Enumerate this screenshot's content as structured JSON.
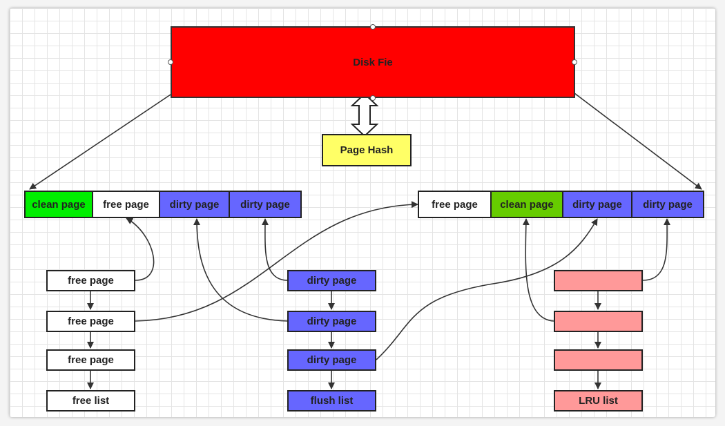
{
  "disk_file": {
    "label": "Disk Fie"
  },
  "page_hash": {
    "label": "Page Hash"
  },
  "buffer_pool_left": [
    "clean page",
    "free page",
    "dirty page",
    "dirty page"
  ],
  "buffer_pool_right": [
    "free page",
    "clean page",
    "dirty page",
    "dirty page"
  ],
  "free_list": {
    "items": [
      "free page",
      "free page",
      "free page"
    ],
    "label": "free list"
  },
  "flush_list": {
    "items": [
      "dirty page",
      "dirty page",
      "dirty page"
    ],
    "label": "flush list"
  },
  "lru_list": {
    "items": [
      "",
      "",
      ""
    ],
    "label": "LRU list"
  },
  "colors": {
    "disk_file": "#ff0000",
    "page_hash": "#ffff66",
    "clean_page_left": "#00ee00",
    "clean_page_right": "#66cc00",
    "free_page": "#ffffff",
    "dirty_page": "#6666ff",
    "lru_node": "#ff9999"
  }
}
